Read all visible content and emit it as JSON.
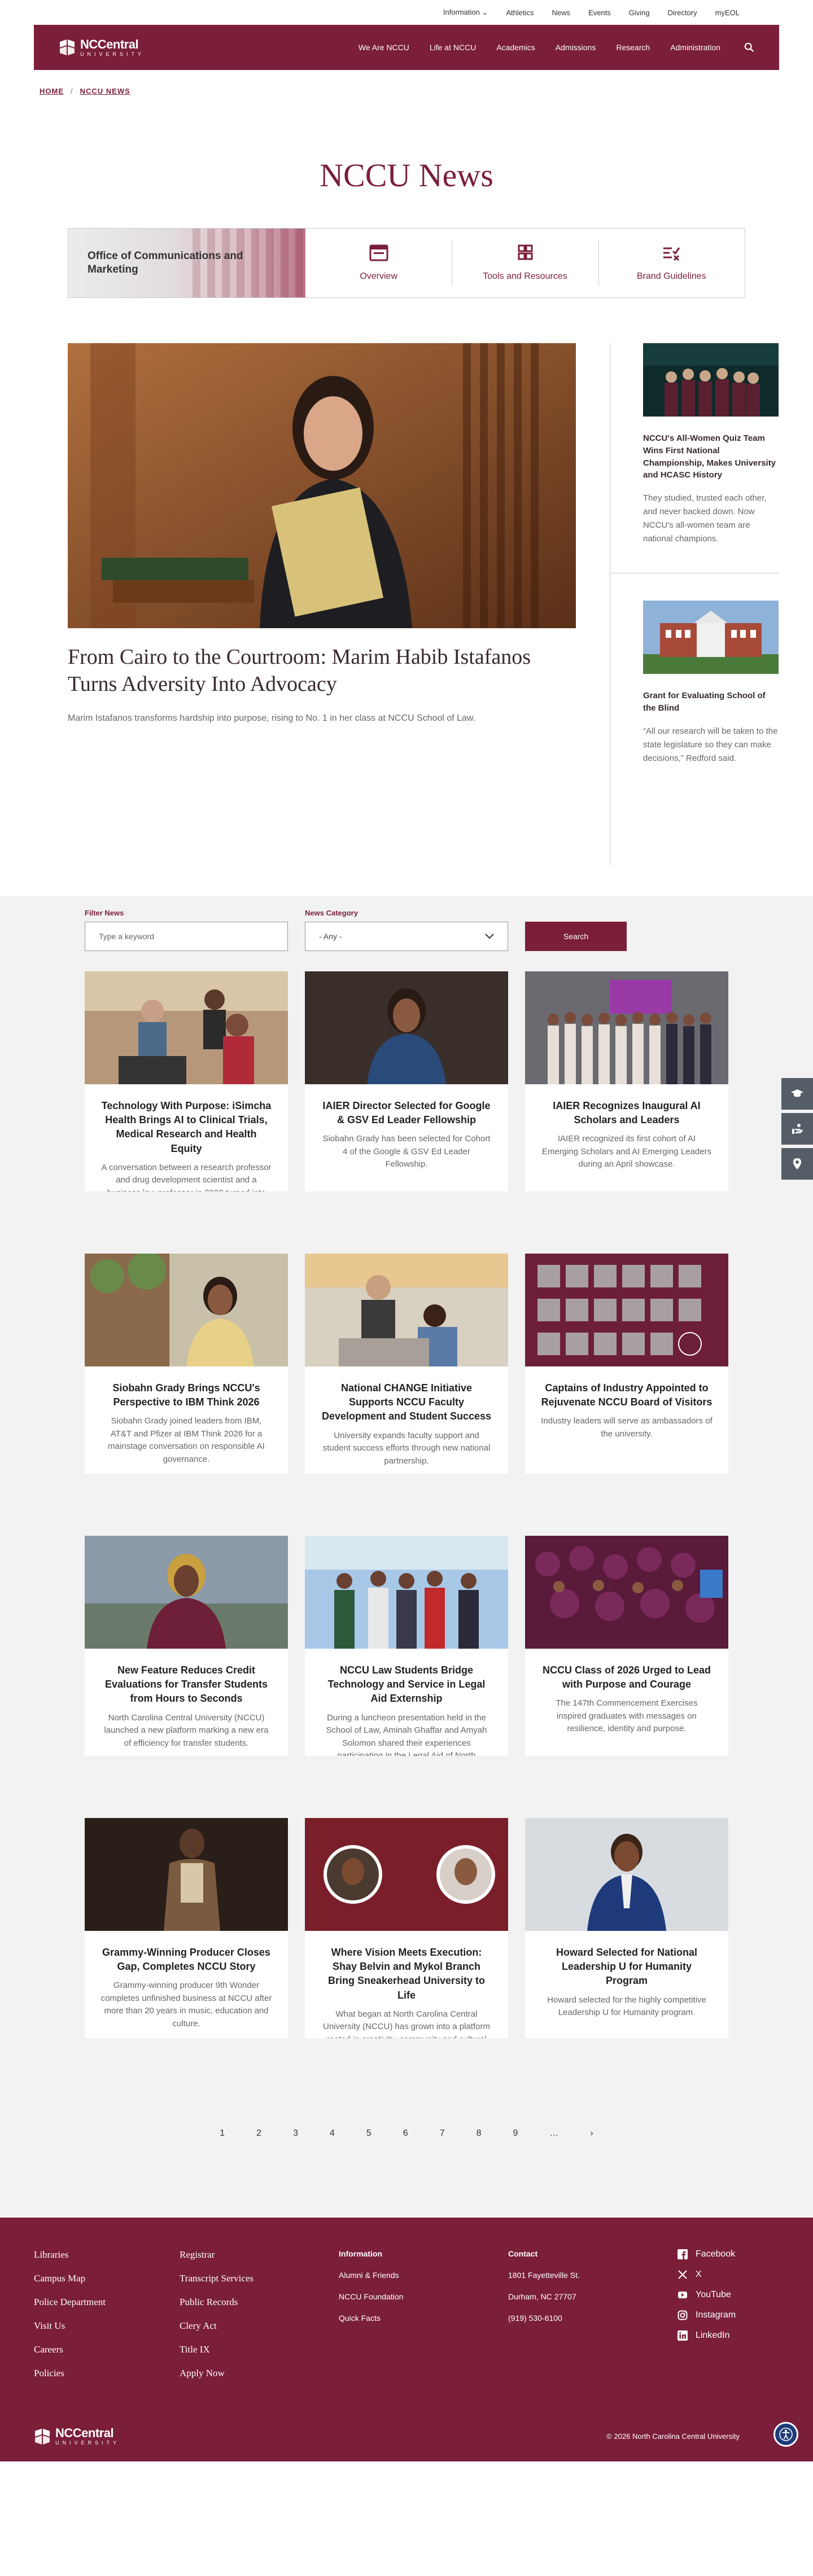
{
  "utility_nav": [
    "Information",
    "Athletics",
    "News",
    "Events",
    "Giving",
    "Directory",
    "myEOL"
  ],
  "brand": {
    "name": "NCCentral",
    "sub": "UNIVERSITY",
    "primary_color": "#7a1e3a"
  },
  "main_nav": [
    "We Are NCCU",
    "Life at NCCU",
    "Academics",
    "Admissions",
    "Research",
    "Administration"
  ],
  "breadcrumb": {
    "home": "HOME",
    "current": "NCCU NEWS"
  },
  "page_title": "NCCU News",
  "office": {
    "label": "Office of Communications and Marketing",
    "links": [
      {
        "label": "Overview",
        "icon": "browser-window-icon"
      },
      {
        "label": "Tools and Resources",
        "icon": "grid-icon"
      },
      {
        "label": "Brand Guidelines",
        "icon": "checklist-icon"
      }
    ]
  },
  "featured": {
    "title": "From Cairo to the Courtroom: Marim Habib Istafanos Turns Adversity Into Advocacy",
    "summary": "Marim Istafanos transforms hardship into purpose, rising to No. 1 in her class at NCCU School of Law."
  },
  "side_stories": [
    {
      "title": "NCCU's All-Women Quiz Team Wins First National Championship, Makes University and HCASC History",
      "text": "They studied, trusted each other, and never backed down. Now NCCU's all-women team are national champions."
    },
    {
      "title": "Grant for Evaluating School of the Blind",
      "text": "“All our research will be taken to the state legislature so they can make decisions,” Redford said."
    }
  ],
  "filters": {
    "filter_label": "Filter News",
    "filter_placeholder": "Type a keyword",
    "category_label": "News Category",
    "category_value": "- Any -",
    "search_label": "Search"
  },
  "cards": [
    {
      "title": "Technology With Purpose: iSimcha Health Brings AI to Clinical Trials, Medical Research and Health Equity",
      "text": "A conversation between a research professor and drug development scientist and a business law professor in 2020 turned into something much bigger: a shared mission to transform how underrepresented communities"
    },
    {
      "title": "IAIER Director Selected for Google & GSV Ed Leader Fellowship",
      "text": "Siobahn Grady has been selected for Cohort 4 of the Google & GSV Ed Leader Fellowship."
    },
    {
      "title": "IAIER Recognizes Inaugural AI Scholars and Leaders",
      "text": "IAIER recognized its first cohort of AI Emerging Scholars and AI Emerging Leaders during an April showcase."
    },
    {
      "title": "Siobahn Grady Brings NCCU's Perspective to IBM Think 2026",
      "text": "Siobahn Grady joined leaders from IBM, AT&T and Pfizer at IBM Think 2026 for a mainstage conversation on responsible AI governance."
    },
    {
      "title": "National CHANGE Initiative Supports NCCU Faculty Development and Student Success",
      "text": "University expands faculty support and student success efforts through new national partnership."
    },
    {
      "title": "Captains of Industry Appointed to Rejuvenate NCCU Board of Visitors",
      "text": "Industry leaders will serve as ambassadors of the university."
    },
    {
      "title": "New Feature Reduces Credit Evaluations for Transfer Students from Hours to Seconds",
      "text": "North Carolina Central University (NCCU) launched a new platform marking a new era of efficiency for transfer students."
    },
    {
      "title": "NCCU Law Students Bridge Technology and Service in Legal Aid Externship",
      "text": "During a luncheon presentation held in the School of Law, Aminah Ghaffar and Amyah Solomon shared their experiences participating in the Legal Aid of North Carolina (LANC) Innovation Lab externship."
    },
    {
      "title": "NCCU Class of 2026 Urged to Lead with Purpose and Courage",
      "text": "The 147th Commencement Exercises inspired graduates with messages on resilience, identity and purpose."
    },
    {
      "title": "Grammy-Winning Producer Closes Gap, Completes NCCU Story",
      "text": "Grammy-winning producer 9th Wonder completes unfinished business at NCCU after more than 20 years in music, education and culture."
    },
    {
      "title": "Where Vision Meets Execution: Shay Belvin and Mykol Branch Bring Sneakerhead University to Life",
      "text": "What began at North Carolina Central University (NCCU) has grown into a platform rooted in creativity, community and cultural impact."
    },
    {
      "title": "Howard Selected for National Leadership U for Humanity Program",
      "text": "Howard selected for the highly competitive Leadership U for Humanity program."
    }
  ],
  "pagination": [
    "1",
    "2",
    "3",
    "4",
    "5",
    "6",
    "7",
    "8",
    "9",
    "…",
    "›"
  ],
  "footer": {
    "col1": [
      "Libraries",
      "Campus Map",
      "Police Department",
      "Visit Us",
      "Careers",
      "Policies"
    ],
    "col2": [
      "Registrar",
      "Transcript Services",
      "Public Records",
      "Clery Act",
      "Title IX",
      "Apply Now"
    ],
    "info_head": "Information",
    "info": [
      "Alumni & Friends",
      "NCCU Foundation",
      "Quick Facts"
    ],
    "contact_head": "Contact",
    "contact": [
      "1801 Fayetteville St.",
      "Durham, NC 27707",
      "(919) 530-6100"
    ],
    "social": [
      {
        "label": "Facebook",
        "icon": "facebook-icon"
      },
      {
        "label": "X",
        "icon": "x-icon"
      },
      {
        "label": "YouTube",
        "icon": "youtube-icon"
      },
      {
        "label": "Instagram",
        "icon": "instagram-icon"
      },
      {
        "label": "LinkedIn",
        "icon": "linkedin-icon"
      }
    ],
    "copyright": "© 2026 North Carolina Central University"
  }
}
